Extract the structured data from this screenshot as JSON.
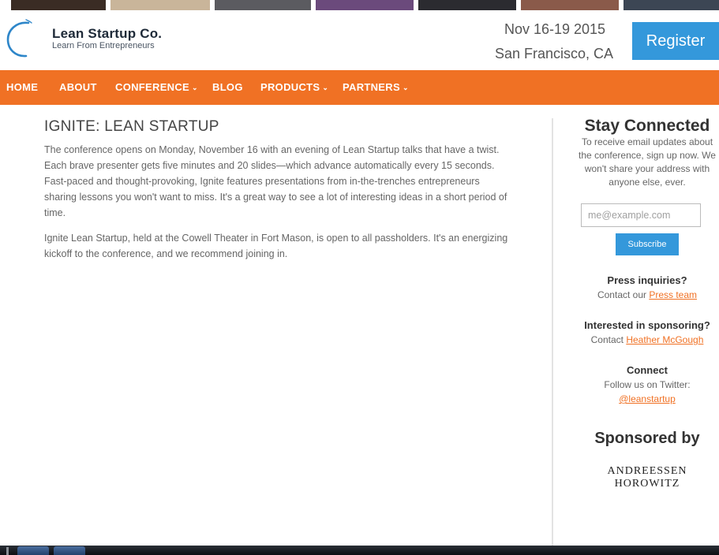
{
  "header": {
    "brand_name": "Lean Startup Co.",
    "brand_tagline": "Learn From Entrepreneurs",
    "event_date": "Nov 16-19 2015",
    "event_location": "San Francisco, CA",
    "register_label": "Register",
    "logo_icon": "circle-ring-logo-icon"
  },
  "nav": {
    "items": [
      {
        "label": "HOME",
        "has_dropdown": false
      },
      {
        "label": "ABOUT",
        "has_dropdown": false
      },
      {
        "label": "CONFERENCE",
        "has_dropdown": true
      },
      {
        "label": "BLOG",
        "has_dropdown": false
      },
      {
        "label": "PRODUCTS",
        "has_dropdown": true
      },
      {
        "label": "PARTNERS",
        "has_dropdown": true
      }
    ],
    "caret": "⌄"
  },
  "main": {
    "title": "IGNITE: LEAN STARTUP",
    "paragraphs": [
      "The conference opens on Monday, November 16 with an evening of Lean Startup talks that have a twist. Each brave presenter gets five minutes and 20 slides—which advance automatically every 15 seconds. Fast-paced and thought-provoking, Ignite features presentations from in-the-trenches entrepreneurs sharing lessons you won't want to miss. It's a great way to see a lot of interesting ideas in a short period of time.",
      "Ignite Lean Startup, held at the Cowell Theater in Fort Mason, is open to all passholders. It's an energizing kickoff to the conference, and we recommend joining in."
    ]
  },
  "sidebar": {
    "stay_connected": {
      "heading": "Stay Connected",
      "text": "To receive email updates about the conference, sign up now. We won't share your address with anyone else, ever.",
      "email_placeholder": "me@example.com",
      "subscribe_label": "Subscribe"
    },
    "press": {
      "heading": "Press inquiries?",
      "prefix": "Contact our ",
      "link": "Press team"
    },
    "sponsoring": {
      "heading": "Interested in sponsoring?",
      "prefix": "Contact ",
      "link": "Heather McGough"
    },
    "connect": {
      "heading": "Connect",
      "text": "Follow us on Twitter:",
      "link": "@leanstartup"
    },
    "sponsored_by": "Sponsored by",
    "sponsor_logo_lines": [
      "ANDREESSEN",
      "HOROWITZ"
    ]
  },
  "colors": {
    "nav_orange": "#f07124",
    "accent_blue": "#3498db",
    "link_orange": "#f07124"
  }
}
